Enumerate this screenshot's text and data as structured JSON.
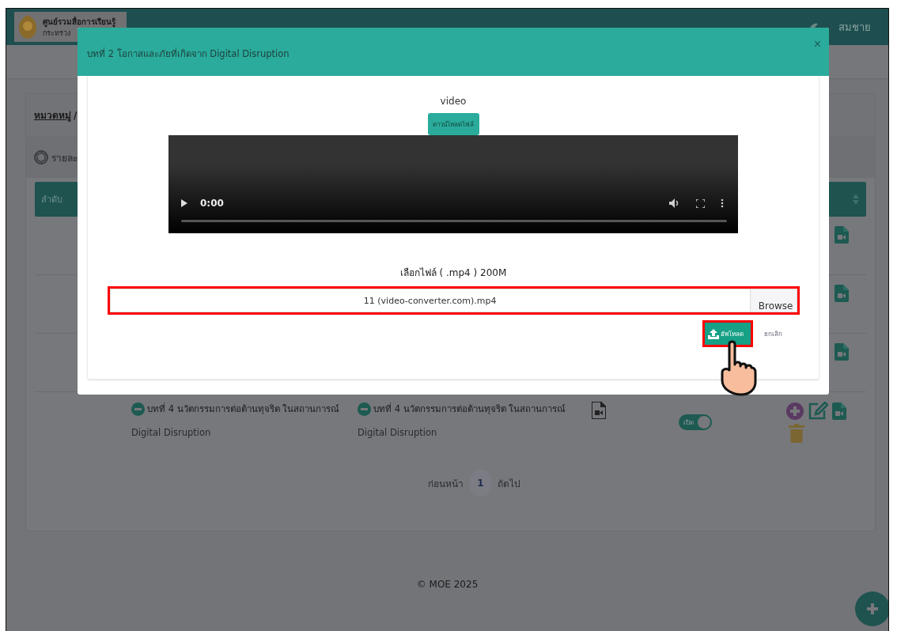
{
  "header": {
    "org_name": "ศูนย์รวมสื่อการเรียนรู้",
    "org_subtitle": "กระทรวง",
    "user_name": "สมชาย"
  },
  "breadcrumb": {
    "link": "หมวดหมู่",
    "separator": "/"
  },
  "section_title": "รายละ",
  "table": {
    "columns": [
      "ลำดับ"
    ],
    "rows": [
      {
        "kind": "covered"
      },
      {
        "kind": "covered"
      },
      {
        "kind": "covered"
      },
      {
        "kind": "lesson",
        "title": "บทที่ 4 นวัตกรรมการต่อต้านทุจริต ในสถานการณ์",
        "subtitle": "Digital Disruption",
        "title_2": "บทที่ 4 นวัตกรรมการต่อต้านทุจริต ในสถานการณ์",
        "subtitle_2": "Digital Disruption",
        "toggle": {
          "label": "เปิด",
          "on": true
        }
      }
    ]
  },
  "pagination": {
    "prev": "ก่อนหน้า",
    "pages": [
      {
        "label": "1",
        "selected": true
      }
    ],
    "next": "ถัดไป"
  },
  "footer": "© MOE 2025",
  "modal": {
    "title": "บทที่ 2 โอกาสและภัยที่เกิดจาก Digital Disruption",
    "close": "×",
    "media_label": "video",
    "download_button": "ดาวน์โหลดไฟล์",
    "player": {
      "time": "0:00"
    },
    "file_label": "เลือกไฟล์ ( .mp4 ) 200M",
    "file_field": {
      "value": "11 (video-converter.com).mp4",
      "browse": "Browse",
      "highlighted": true
    },
    "upload_button": {
      "label": "อัพโหลด",
      "highlighted": true
    },
    "cancel": "ยกเลิก"
  }
}
